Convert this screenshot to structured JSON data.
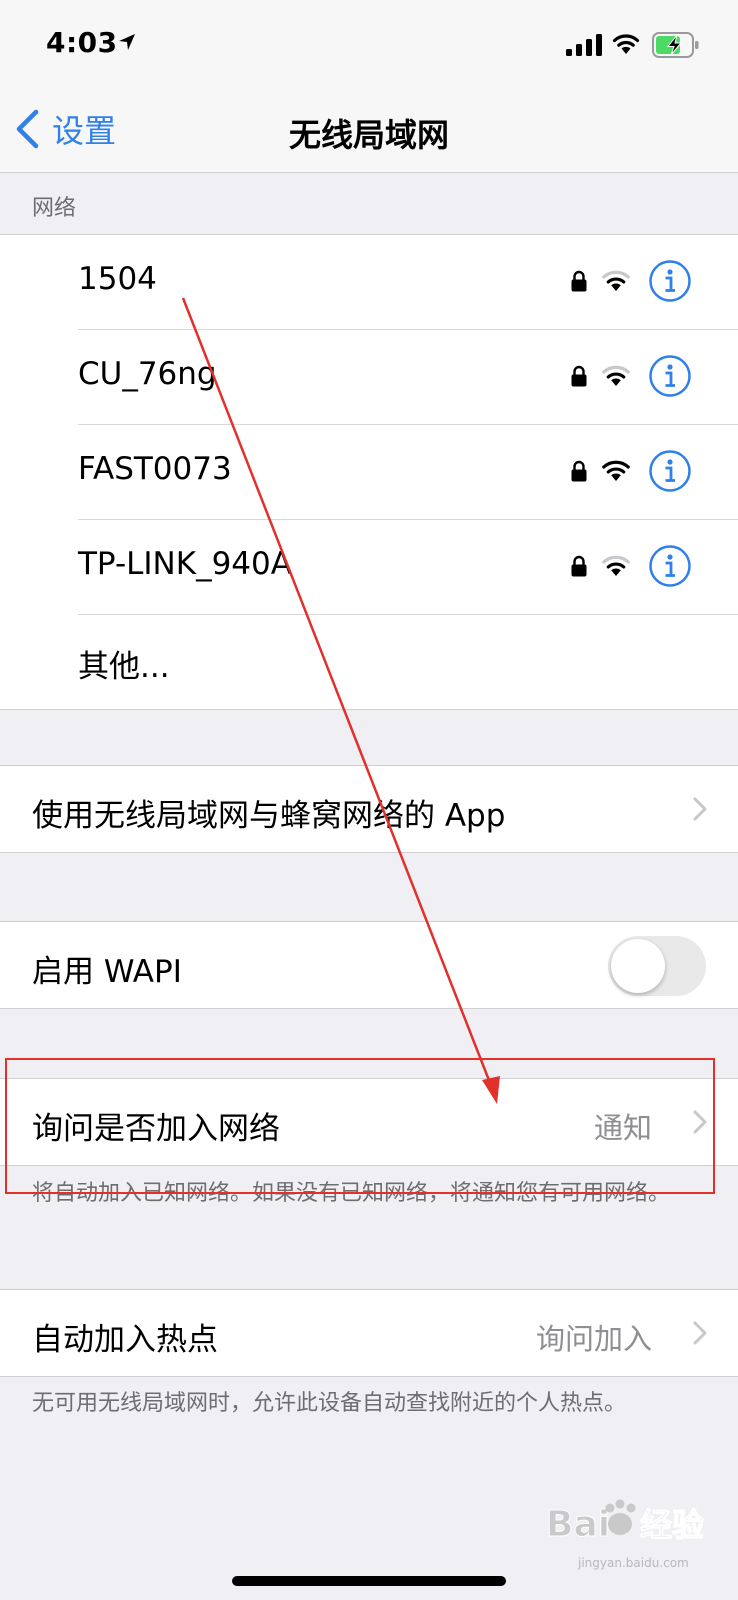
{
  "status_bar": {
    "time": "4:03"
  },
  "nav": {
    "back_label": "设置",
    "title": "无线局域网"
  },
  "networks_section": {
    "header": "网络",
    "items": [
      {
        "name": "1504"
      },
      {
        "name": "CU_76ng"
      },
      {
        "name": "FAST0073"
      },
      {
        "name": "TP-LINK_940A"
      }
    ],
    "other_label": "其他..."
  },
  "apps_cell": {
    "label": "使用无线局域网与蜂窝网络的 App"
  },
  "wapi_cell": {
    "label": "启用 WAPI"
  },
  "ask_join_cell": {
    "label": "询问是否加入网络",
    "value": "通知",
    "note": "将自动加入已知网络。如果没有已知网络，将通知您有可用网络。"
  },
  "hotspot_cell": {
    "label": "自动加入热点",
    "value": "询问加入",
    "note": "无可用无线局域网时，允许此设备自动查找附近的个人热点。"
  },
  "watermark": {
    "brand": "Bai",
    "brand2": "经验",
    "url": "jingyan.baidu.com"
  },
  "colors": {
    "accent": "#2f80e8",
    "annotation": "#e2302a",
    "toggle_off": "#e9e9ea"
  }
}
